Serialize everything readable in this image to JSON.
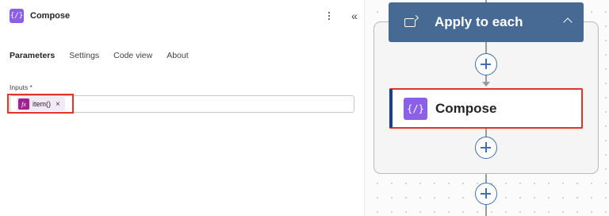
{
  "panel": {
    "action_icon_glyph": "{/}",
    "title": "Compose",
    "more_options_icon": "vertical-dots-icon",
    "collapse_panel_glyph": "«",
    "tabs": [
      {
        "label": "Parameters",
        "active": true
      },
      {
        "label": "Settings",
        "active": false
      },
      {
        "label": "Code view",
        "active": false
      },
      {
        "label": "About",
        "active": false
      }
    ],
    "inputs_field": {
      "label": "Inputs *",
      "token": {
        "icon_glyph": "fx",
        "text": "item()",
        "remove_glyph": "×"
      }
    }
  },
  "canvas": {
    "loop_node": {
      "icon": "loop-icon",
      "title": "Apply to each",
      "collapse_icon": "chevron-up-icon",
      "color": "#476a94"
    },
    "compose_node": {
      "icon_glyph": "{/}",
      "title": "Compose",
      "icon_color": "#8b5fe8"
    },
    "add_buttons": [
      "add-step-inside-loop-top",
      "add-step-inside-loop-bottom",
      "add-step-after-loop"
    ]
  },
  "colors": {
    "highlight": "#e2352c",
    "accent_blue": "#3c6fb3",
    "fx_token": "#a0228f"
  }
}
